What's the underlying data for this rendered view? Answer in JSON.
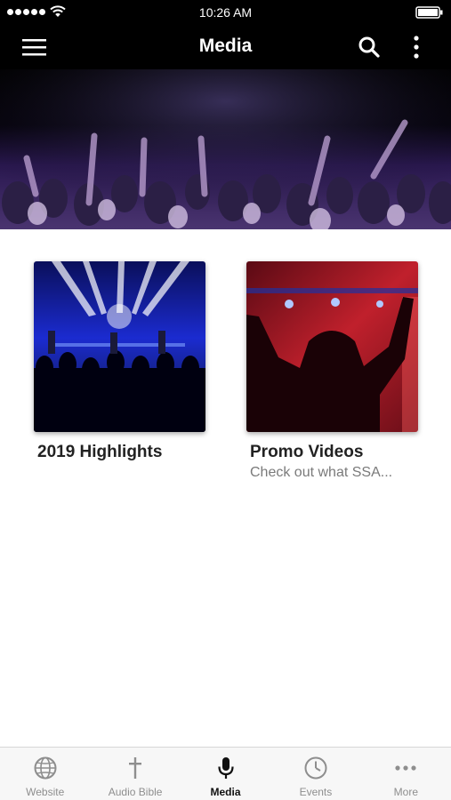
{
  "status_bar": {
    "time": "10:26 AM"
  },
  "nav": {
    "title": "Media",
    "icons": [
      "menu-icon",
      "search-icon",
      "more-vertical-icon"
    ]
  },
  "cards": [
    {
      "title": "2019 Highlights",
      "subtitle": ""
    },
    {
      "title": "Promo Videos",
      "subtitle": "Check out what SSA..."
    }
  ],
  "tabs": [
    {
      "label": "Website",
      "icon": "globe-icon",
      "active": false
    },
    {
      "label": "Audio Bible",
      "icon": "cross-icon",
      "active": false
    },
    {
      "label": "Media",
      "icon": "microphone-icon",
      "active": true
    },
    {
      "label": "Events",
      "icon": "clock-icon",
      "active": false
    },
    {
      "label": "More",
      "icon": "more-horizontal-icon",
      "active": false
    }
  ],
  "colors": {
    "bar_background": "#000000",
    "tab_active": "#111111",
    "tab_inactive": "#8e8e8e"
  }
}
